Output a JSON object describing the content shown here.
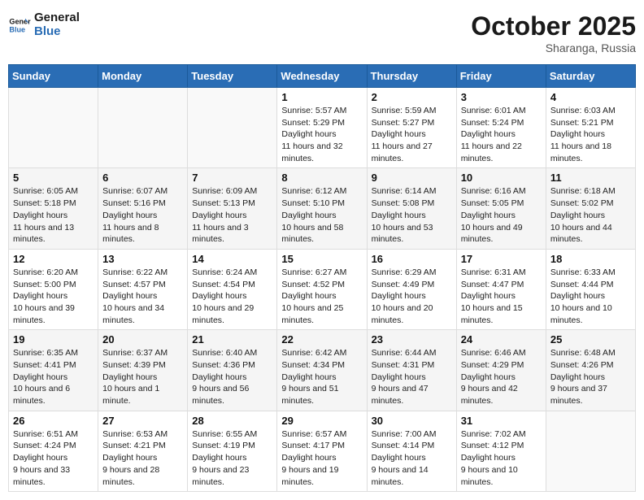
{
  "header": {
    "logo_line1": "General",
    "logo_line2": "Blue",
    "month": "October 2025",
    "location": "Sharanga, Russia"
  },
  "weekdays": [
    "Sunday",
    "Monday",
    "Tuesday",
    "Wednesday",
    "Thursday",
    "Friday",
    "Saturday"
  ],
  "weeks": [
    [
      {
        "day": "",
        "empty": true
      },
      {
        "day": "",
        "empty": true
      },
      {
        "day": "",
        "empty": true
      },
      {
        "day": "1",
        "sunrise": "5:57 AM",
        "sunset": "5:29 PM",
        "daylight": "11 hours and 32 minutes."
      },
      {
        "day": "2",
        "sunrise": "5:59 AM",
        "sunset": "5:27 PM",
        "daylight": "11 hours and 27 minutes."
      },
      {
        "day": "3",
        "sunrise": "6:01 AM",
        "sunset": "5:24 PM",
        "daylight": "11 hours and 22 minutes."
      },
      {
        "day": "4",
        "sunrise": "6:03 AM",
        "sunset": "5:21 PM",
        "daylight": "11 hours and 18 minutes."
      }
    ],
    [
      {
        "day": "5",
        "sunrise": "6:05 AM",
        "sunset": "5:18 PM",
        "daylight": "11 hours and 13 minutes."
      },
      {
        "day": "6",
        "sunrise": "6:07 AM",
        "sunset": "5:16 PM",
        "daylight": "11 hours and 8 minutes."
      },
      {
        "day": "7",
        "sunrise": "6:09 AM",
        "sunset": "5:13 PM",
        "daylight": "11 hours and 3 minutes."
      },
      {
        "day": "8",
        "sunrise": "6:12 AM",
        "sunset": "5:10 PM",
        "daylight": "10 hours and 58 minutes."
      },
      {
        "day": "9",
        "sunrise": "6:14 AM",
        "sunset": "5:08 PM",
        "daylight": "10 hours and 53 minutes."
      },
      {
        "day": "10",
        "sunrise": "6:16 AM",
        "sunset": "5:05 PM",
        "daylight": "10 hours and 49 minutes."
      },
      {
        "day": "11",
        "sunrise": "6:18 AM",
        "sunset": "5:02 PM",
        "daylight": "10 hours and 44 minutes."
      }
    ],
    [
      {
        "day": "12",
        "sunrise": "6:20 AM",
        "sunset": "5:00 PM",
        "daylight": "10 hours and 39 minutes."
      },
      {
        "day": "13",
        "sunrise": "6:22 AM",
        "sunset": "4:57 PM",
        "daylight": "10 hours and 34 minutes."
      },
      {
        "day": "14",
        "sunrise": "6:24 AM",
        "sunset": "4:54 PM",
        "daylight": "10 hours and 29 minutes."
      },
      {
        "day": "15",
        "sunrise": "6:27 AM",
        "sunset": "4:52 PM",
        "daylight": "10 hours and 25 minutes."
      },
      {
        "day": "16",
        "sunrise": "6:29 AM",
        "sunset": "4:49 PM",
        "daylight": "10 hours and 20 minutes."
      },
      {
        "day": "17",
        "sunrise": "6:31 AM",
        "sunset": "4:47 PM",
        "daylight": "10 hours and 15 minutes."
      },
      {
        "day": "18",
        "sunrise": "6:33 AM",
        "sunset": "4:44 PM",
        "daylight": "10 hours and 10 minutes."
      }
    ],
    [
      {
        "day": "19",
        "sunrise": "6:35 AM",
        "sunset": "4:41 PM",
        "daylight": "10 hours and 6 minutes."
      },
      {
        "day": "20",
        "sunrise": "6:37 AM",
        "sunset": "4:39 PM",
        "daylight": "10 hours and 1 minute."
      },
      {
        "day": "21",
        "sunrise": "6:40 AM",
        "sunset": "4:36 PM",
        "daylight": "9 hours and 56 minutes."
      },
      {
        "day": "22",
        "sunrise": "6:42 AM",
        "sunset": "4:34 PM",
        "daylight": "9 hours and 51 minutes."
      },
      {
        "day": "23",
        "sunrise": "6:44 AM",
        "sunset": "4:31 PM",
        "daylight": "9 hours and 47 minutes."
      },
      {
        "day": "24",
        "sunrise": "6:46 AM",
        "sunset": "4:29 PM",
        "daylight": "9 hours and 42 minutes."
      },
      {
        "day": "25",
        "sunrise": "6:48 AM",
        "sunset": "4:26 PM",
        "daylight": "9 hours and 37 minutes."
      }
    ],
    [
      {
        "day": "26",
        "sunrise": "6:51 AM",
        "sunset": "4:24 PM",
        "daylight": "9 hours and 33 minutes."
      },
      {
        "day": "27",
        "sunrise": "6:53 AM",
        "sunset": "4:21 PM",
        "daylight": "9 hours and 28 minutes."
      },
      {
        "day": "28",
        "sunrise": "6:55 AM",
        "sunset": "4:19 PM",
        "daylight": "9 hours and 23 minutes."
      },
      {
        "day": "29",
        "sunrise": "6:57 AM",
        "sunset": "4:17 PM",
        "daylight": "9 hours and 19 minutes."
      },
      {
        "day": "30",
        "sunrise": "7:00 AM",
        "sunset": "4:14 PM",
        "daylight": "9 hours and 14 minutes."
      },
      {
        "day": "31",
        "sunrise": "7:02 AM",
        "sunset": "4:12 PM",
        "daylight": "9 hours and 10 minutes."
      },
      {
        "day": "",
        "empty": true
      }
    ]
  ]
}
